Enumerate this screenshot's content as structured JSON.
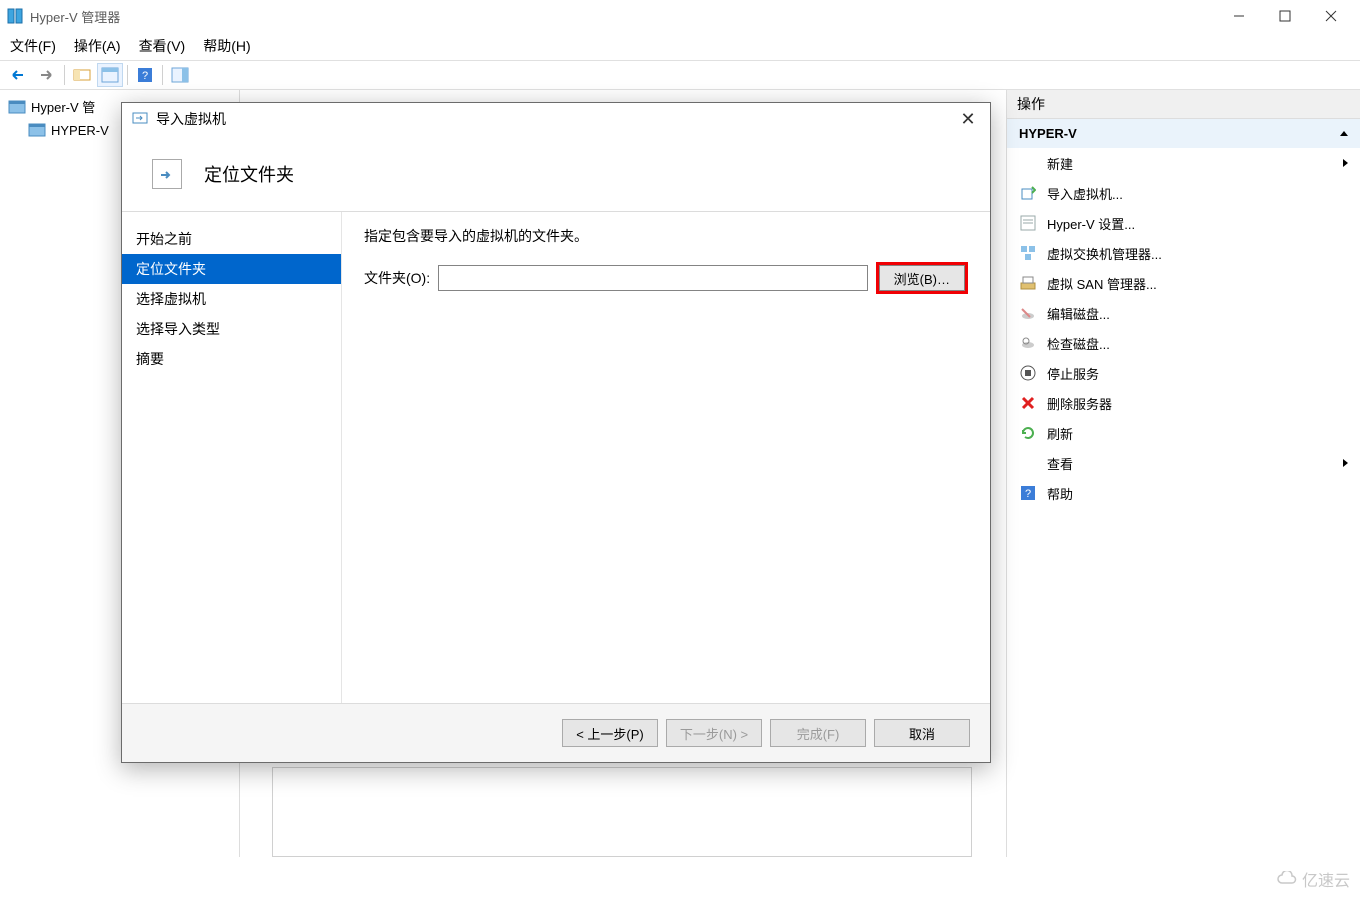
{
  "titlebar": {
    "title": "Hyper-V 管理器"
  },
  "menubar": {
    "file": "文件(F)",
    "action": "操作(A)",
    "view": "查看(V)",
    "help": "帮助(H)"
  },
  "toolbar": {
    "back": "←",
    "forward": "→"
  },
  "tree": {
    "root": "Hyper-V 管",
    "server": "HYPER-V"
  },
  "actions": {
    "header": "操作",
    "server": "HYPER-V",
    "items": [
      {
        "label": "新建",
        "hasSub": true
      },
      {
        "label": "导入虚拟机..."
      },
      {
        "label": "Hyper-V 设置..."
      },
      {
        "label": "虚拟交换机管理器..."
      },
      {
        "label": "虚拟 SAN 管理器..."
      },
      {
        "label": "编辑磁盘..."
      },
      {
        "label": "检查磁盘..."
      },
      {
        "label": "停止服务"
      },
      {
        "label": "删除服务器"
      },
      {
        "label": "刷新"
      },
      {
        "label": "查看",
        "hasSub": true
      },
      {
        "label": "帮助"
      }
    ]
  },
  "dialog": {
    "title": "导入虚拟机",
    "head_title": "定位文件夹",
    "nav": [
      "开始之前",
      "定位文件夹",
      "选择虚拟机",
      "选择导入类型",
      "摘要"
    ],
    "desc": "指定包含要导入的虚拟机的文件夹。",
    "folder_label": "文件夹(O):",
    "folder_value": "",
    "browse": "浏览(B)…",
    "prev": "< 上一步(P)",
    "next": "下一步(N) >",
    "finish": "完成(F)",
    "cancel": "取消"
  },
  "watermark": "亿速云"
}
